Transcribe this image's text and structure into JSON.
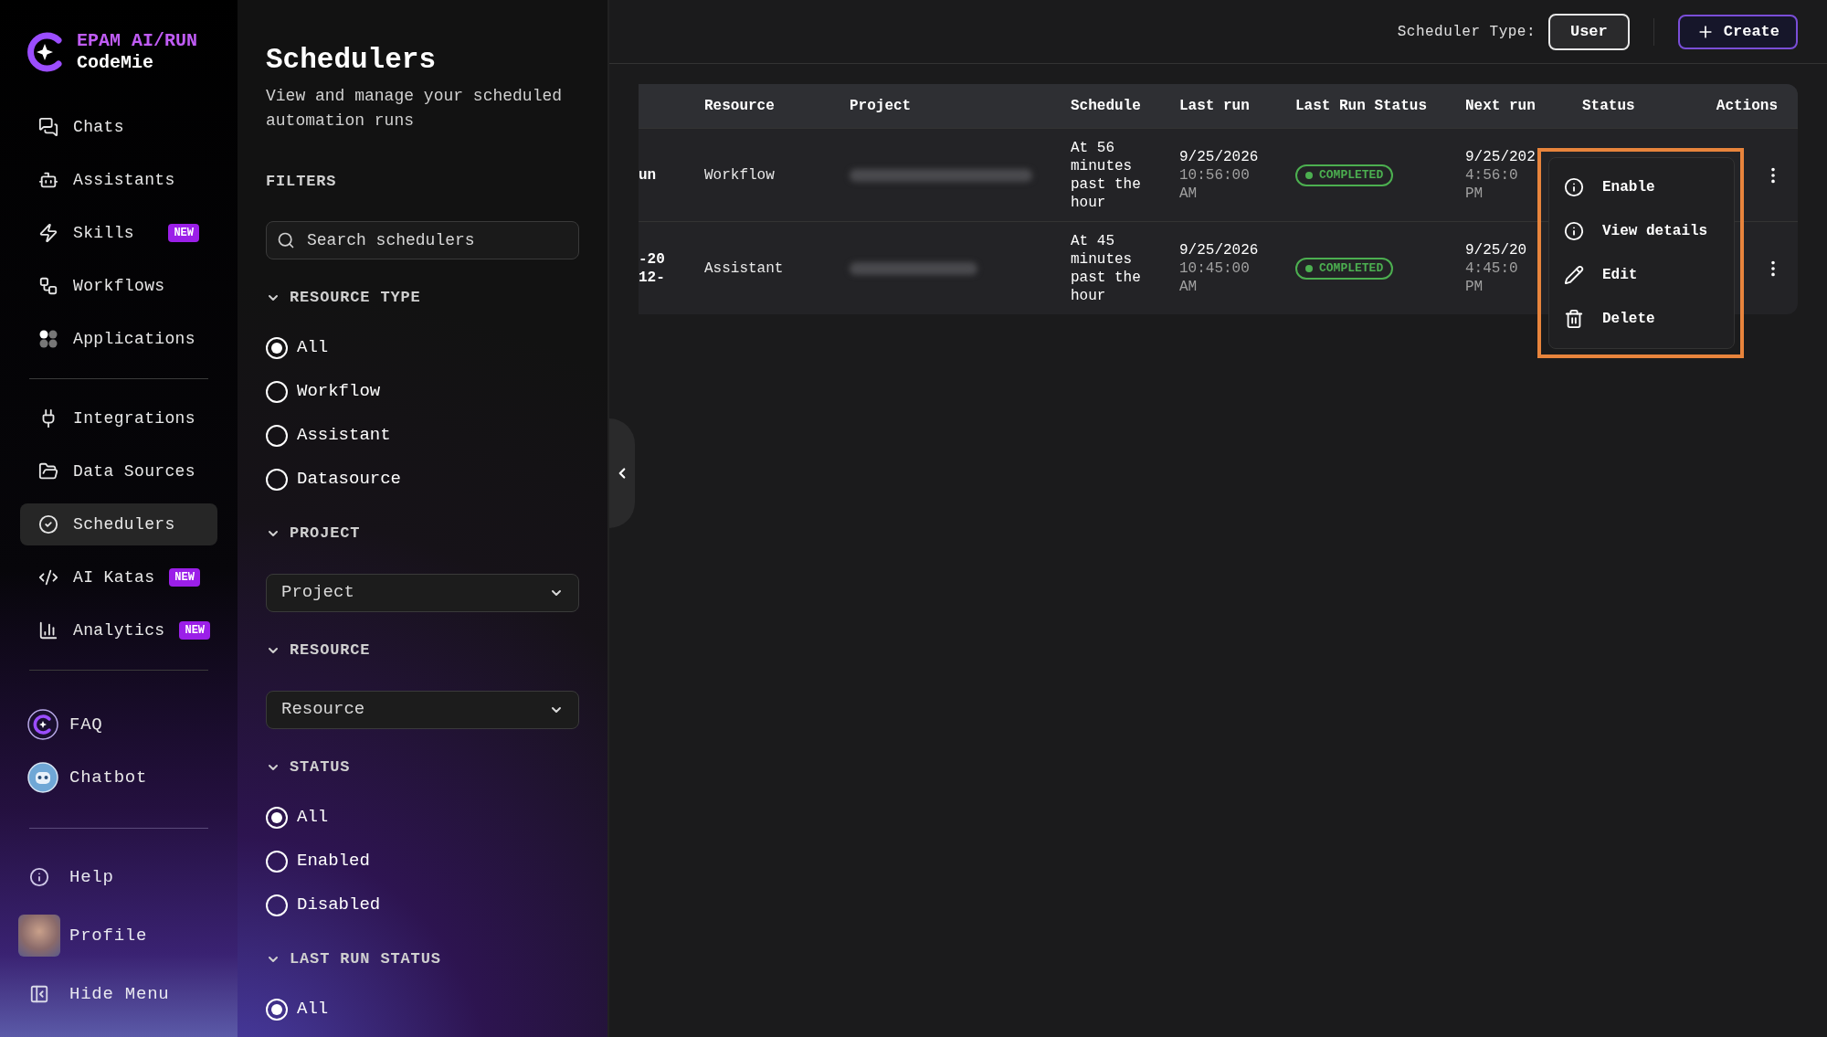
{
  "sidebar": {
    "brand": {
      "line1": "EPAM AI/RUN",
      "line2": "CodeMie"
    },
    "nav_groups": [
      {
        "items": [
          {
            "label": "Chats",
            "selected": false
          },
          {
            "label": "Assistants",
            "selected": false
          },
          {
            "label": "Skills",
            "selected": false,
            "badge": "NEW"
          },
          {
            "label": "Workflows",
            "selected": false
          },
          {
            "label": "Applications",
            "selected": false
          }
        ]
      },
      {
        "items": [
          {
            "label": "Integrations",
            "selected": false
          },
          {
            "label": "Data Sources",
            "selected": false
          },
          {
            "label": "Schedulers",
            "selected": true
          },
          {
            "label": "AI Katas",
            "selected": false,
            "badge": "NEW"
          },
          {
            "label": "Analytics",
            "selected": false,
            "badge": "NEW"
          }
        ]
      }
    ],
    "links": [
      {
        "label": "FAQ"
      },
      {
        "label": "Chatbot"
      }
    ],
    "footer": [
      {
        "label": "Help"
      },
      {
        "label": "Profile"
      },
      {
        "label": "Hide Menu"
      }
    ]
  },
  "filters_panel": {
    "title": "Schedulers",
    "subtitle": "View and manage your scheduled automation runs",
    "filters_label": "FILTERS",
    "search": {
      "placeholder": "Search schedulers"
    },
    "sections": [
      {
        "kind": "radio",
        "title": "RESOURCE TYPE",
        "expanded": true,
        "options": [
          {
            "label": "All",
            "selected": true
          },
          {
            "label": "Workflow",
            "selected": false
          },
          {
            "label": "Assistant",
            "selected": false
          },
          {
            "label": "Datasource",
            "selected": false
          }
        ]
      },
      {
        "kind": "select",
        "title": "PROJECT",
        "expanded": true,
        "placeholder": "Project"
      },
      {
        "kind": "select",
        "title": "RESOURCE",
        "expanded": true,
        "placeholder": "Resource"
      },
      {
        "kind": "radio",
        "title": "STATUS",
        "expanded": true,
        "options": [
          {
            "label": "All",
            "selected": true
          },
          {
            "label": "Enabled",
            "selected": false
          },
          {
            "label": "Disabled",
            "selected": false
          }
        ]
      },
      {
        "kind": "radio",
        "title": "LAST RUN STATUS",
        "expanded": true,
        "options": [
          {
            "label": "All",
            "selected": true
          }
        ]
      }
    ]
  },
  "top_bar": {
    "scheduler_type_label": "Scheduler Type:",
    "scheduler_type_value": "User",
    "create_button": "Create"
  },
  "table": {
    "columns": [
      "Resource",
      "Project",
      "Schedule",
      "Last run",
      "Last Run Status",
      "Next run",
      "Status",
      "Actions"
    ],
    "rows": [
      {
        "column_1": [
          "un"
        ],
        "resource": "Workflow",
        "schedule": "At 56 minutes past the hour",
        "last_run_date": "9/25/2026",
        "last_run_time": "10:56:00 AM",
        "last_run_status": {
          "label": "COMPLETED",
          "color": "#4caf50"
        },
        "next_run": [
          "9/25/202",
          "4:56:0",
          "PM"
        ]
      },
      {
        "column_1": [
          "-20",
          "12-"
        ],
        "resource": "Assistant",
        "schedule": "At 45 minutes past the hour",
        "last_run_date": "9/25/2026",
        "last_run_time": "10:45:00 AM",
        "last_run_status": {
          "label": "COMPLETED",
          "color": "#4caf50"
        },
        "next_run": [
          "9/25/20",
          "4:45:0",
          "PM"
        ]
      }
    ]
  },
  "row_menu": {
    "open": true,
    "items": [
      {
        "label": "Enable"
      },
      {
        "label": "View details"
      },
      {
        "label": "Edit"
      },
      {
        "label": "Delete"
      }
    ]
  }
}
